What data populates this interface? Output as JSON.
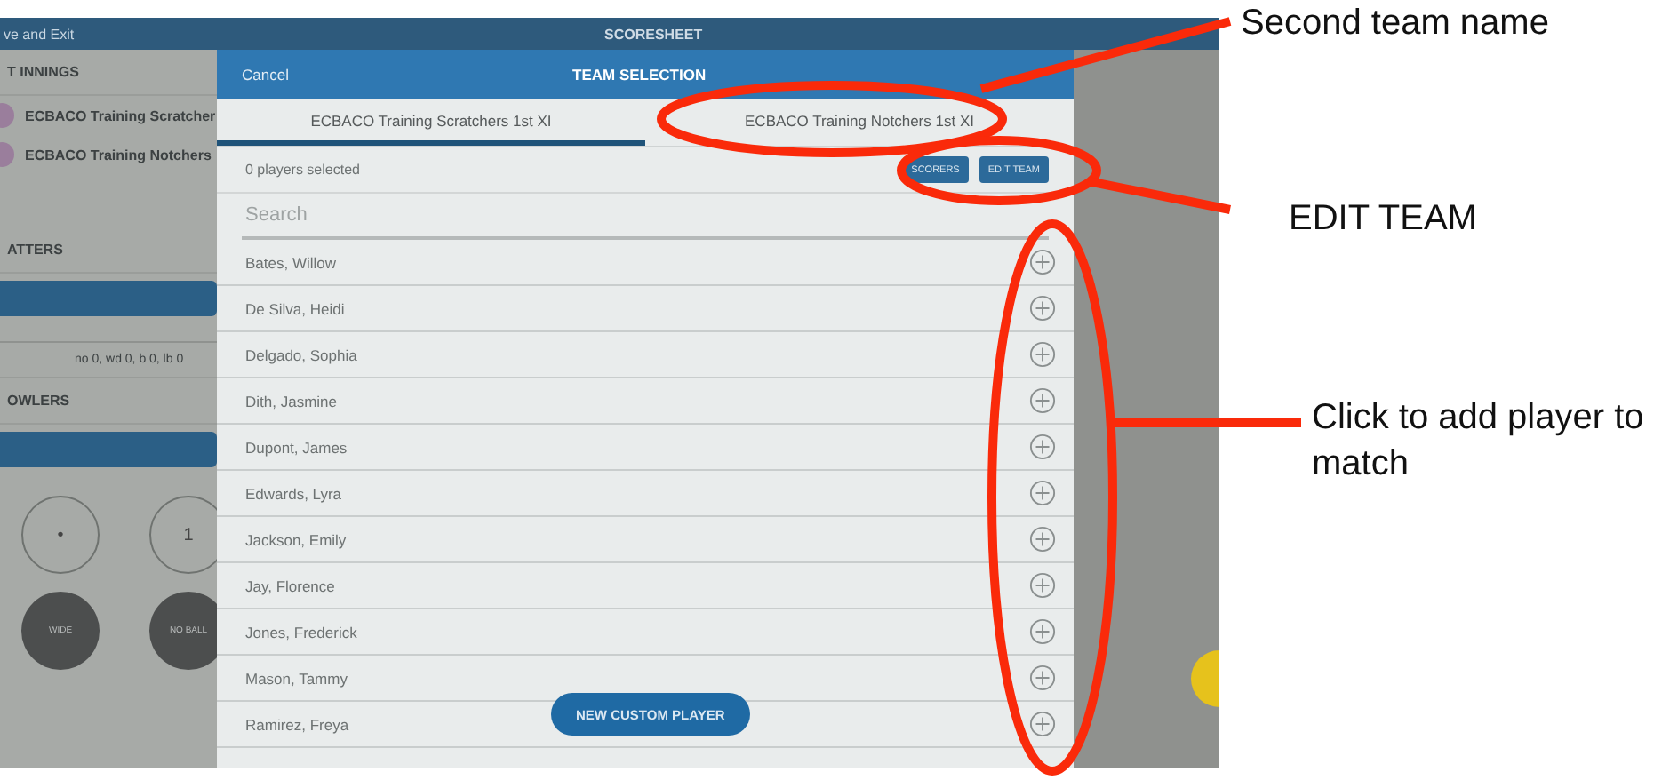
{
  "app_bar": {
    "back": "ve and Exit",
    "title": "SCORESHEET"
  },
  "sidebar": {
    "innings_heading": "T INNINGS",
    "teams": [
      {
        "name": "ECBACO Training Scratcher"
      },
      {
        "name": "ECBACO Training Notchers"
      }
    ],
    "batters_heading": "ATTERS",
    "extras": "no 0, wd 0, b 0, lb 0",
    "bowlers_heading": "OWLERS",
    "ball_buttons": [
      {
        "label": "•",
        "kind": "outline"
      },
      {
        "label": "1",
        "kind": "outline"
      },
      {
        "label": "WIDE",
        "kind": "filled"
      },
      {
        "label": "NO BALL",
        "kind": "filled"
      }
    ]
  },
  "modal": {
    "cancel": "Cancel",
    "title": "TEAM SELECTION",
    "tabs": [
      {
        "label": "ECBACO Training Scratchers 1st XI",
        "selected": true
      },
      {
        "label": "ECBACO Training Notchers 1st XI",
        "selected": false
      }
    ],
    "selected_count": "0 players selected",
    "buttons": [
      "SCORERS",
      "EDIT TEAM"
    ],
    "search": {
      "placeholder": "Search"
    },
    "players": [
      {
        "name": "Bates, Willow"
      },
      {
        "name": "De Silva, Heidi"
      },
      {
        "name": "Delgado, Sophia"
      },
      {
        "name": "Dith, Jasmine"
      },
      {
        "name": "Dupont, James"
      },
      {
        "name": "Edwards, Lyra"
      },
      {
        "name": "Jackson, Emily"
      },
      {
        "name": "Jay, Florence"
      },
      {
        "name": "Jones, Frederick"
      },
      {
        "name": "Mason, Tammy"
      },
      {
        "name": "Ramirez, Freya"
      }
    ],
    "new_player_button": "NEW CUSTOM PLAYER"
  },
  "annotations": [
    {
      "label": "Second team name"
    },
    {
      "label": "EDIT TEAM"
    },
    {
      "label": "Click to add player to match"
    }
  ]
}
